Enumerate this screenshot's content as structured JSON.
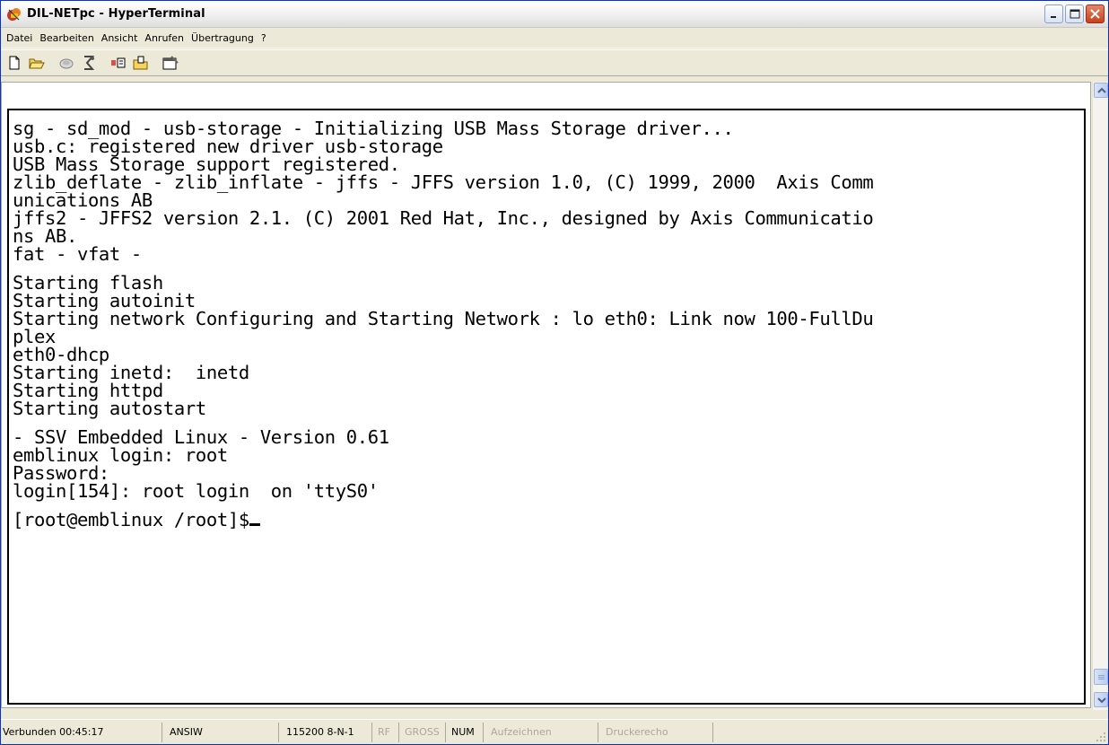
{
  "window": {
    "title": "DIL-NETpc - HyperTerminal",
    "icon": "hyperterminal-icon",
    "controls": [
      "minimize-icon",
      "maximize-icon",
      "close-icon"
    ]
  },
  "menu": {
    "items": [
      {
        "label": "Datei"
      },
      {
        "label": "Bearbeiten"
      },
      {
        "label": "Ansicht"
      },
      {
        "label": "Anrufen"
      },
      {
        "label": "Übertragung"
      },
      {
        "label": "?"
      }
    ]
  },
  "toolbar": {
    "buttons": [
      "new-icon",
      "open-icon",
      "call-icon",
      "disconnect-icon",
      "send-icon",
      "receive-icon",
      "properties-icon"
    ]
  },
  "terminal": {
    "lines": [
      "sg - sd_mod - usb-storage - Initializing USB Mass Storage driver...",
      "usb.c: registered new driver usb-storage",
      "USB Mass Storage support registered.",
      "zlib_deflate - zlib_inflate - jffs - JFFS version 1.0, (C) 1999, 2000  Axis Comm",
      "unications AB",
      "jffs2 - JFFS2 version 2.1. (C) 2001 Red Hat, Inc., designed by Axis Communicatio",
      "ns AB.",
      "fat - vfat -",
      "",
      "Starting flash",
      "Starting autoinit",
      "Starting network Configuring and Starting Network : lo eth0: Link now 100-FullDu",
      "plex",
      "eth0-dhcp",
      "Starting inetd:  inetd",
      "Starting httpd",
      "Starting autostart",
      "",
      "- SSV Embedded Linux - Version 0.61",
      "emblinux login: root",
      "Password:",
      "login[154]: root login  on 'ttyS0'",
      "",
      "[root@emblinux /root]$"
    ]
  },
  "statusbar": {
    "connected": "Verbunden 00:45:17",
    "emulation": "ANSIW",
    "settings": "115200 8-N-1",
    "rf": "RF",
    "caps": "GROSS",
    "num": "NUM",
    "capture": "Aufzeichnen",
    "print_echo": "Druckerecho"
  }
}
